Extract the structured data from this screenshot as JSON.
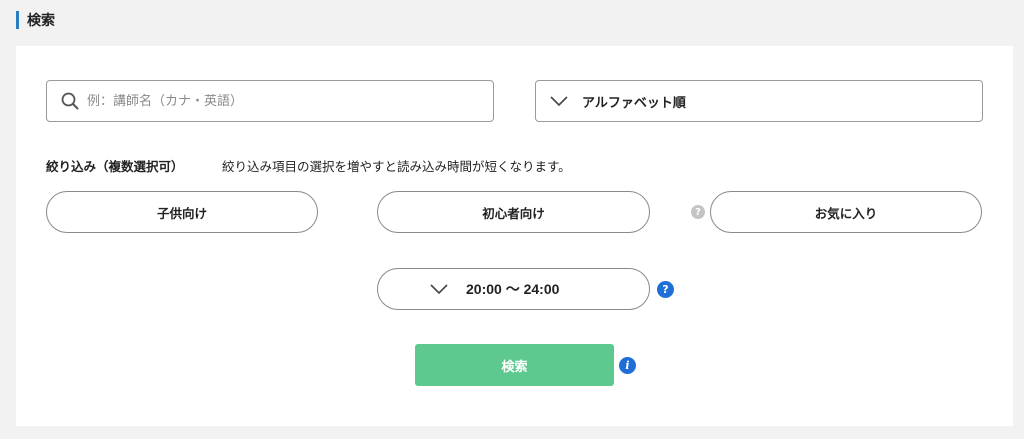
{
  "section": {
    "title": "検索"
  },
  "search": {
    "placeholder": "例：講師名（カナ・英語）",
    "value": ""
  },
  "sort": {
    "selected": "アルファベット順"
  },
  "filter": {
    "heading": "絞り込み（複数選択可）",
    "note": "絞り込み項目の選択を増やすと読み込み時間が短くなります。",
    "options": [
      "子供向け",
      "初心者向け",
      "お気に入り"
    ]
  },
  "time": {
    "selected": "20:00 〜 24:00"
  },
  "help": {
    "question_mark": "?",
    "info_mark": "i"
  },
  "submit": {
    "label": "検索"
  },
  "colors": {
    "accent": "#2a7fc1",
    "submit": "#5ec98e",
    "help_blue": "#1f6fd6",
    "help_gray": "#c4c4c4"
  },
  "icons": {
    "search": "search-icon",
    "sort": "chevron-down-icon",
    "time": "chevron-down-icon",
    "help": "help-icon",
    "info": "info-icon"
  }
}
